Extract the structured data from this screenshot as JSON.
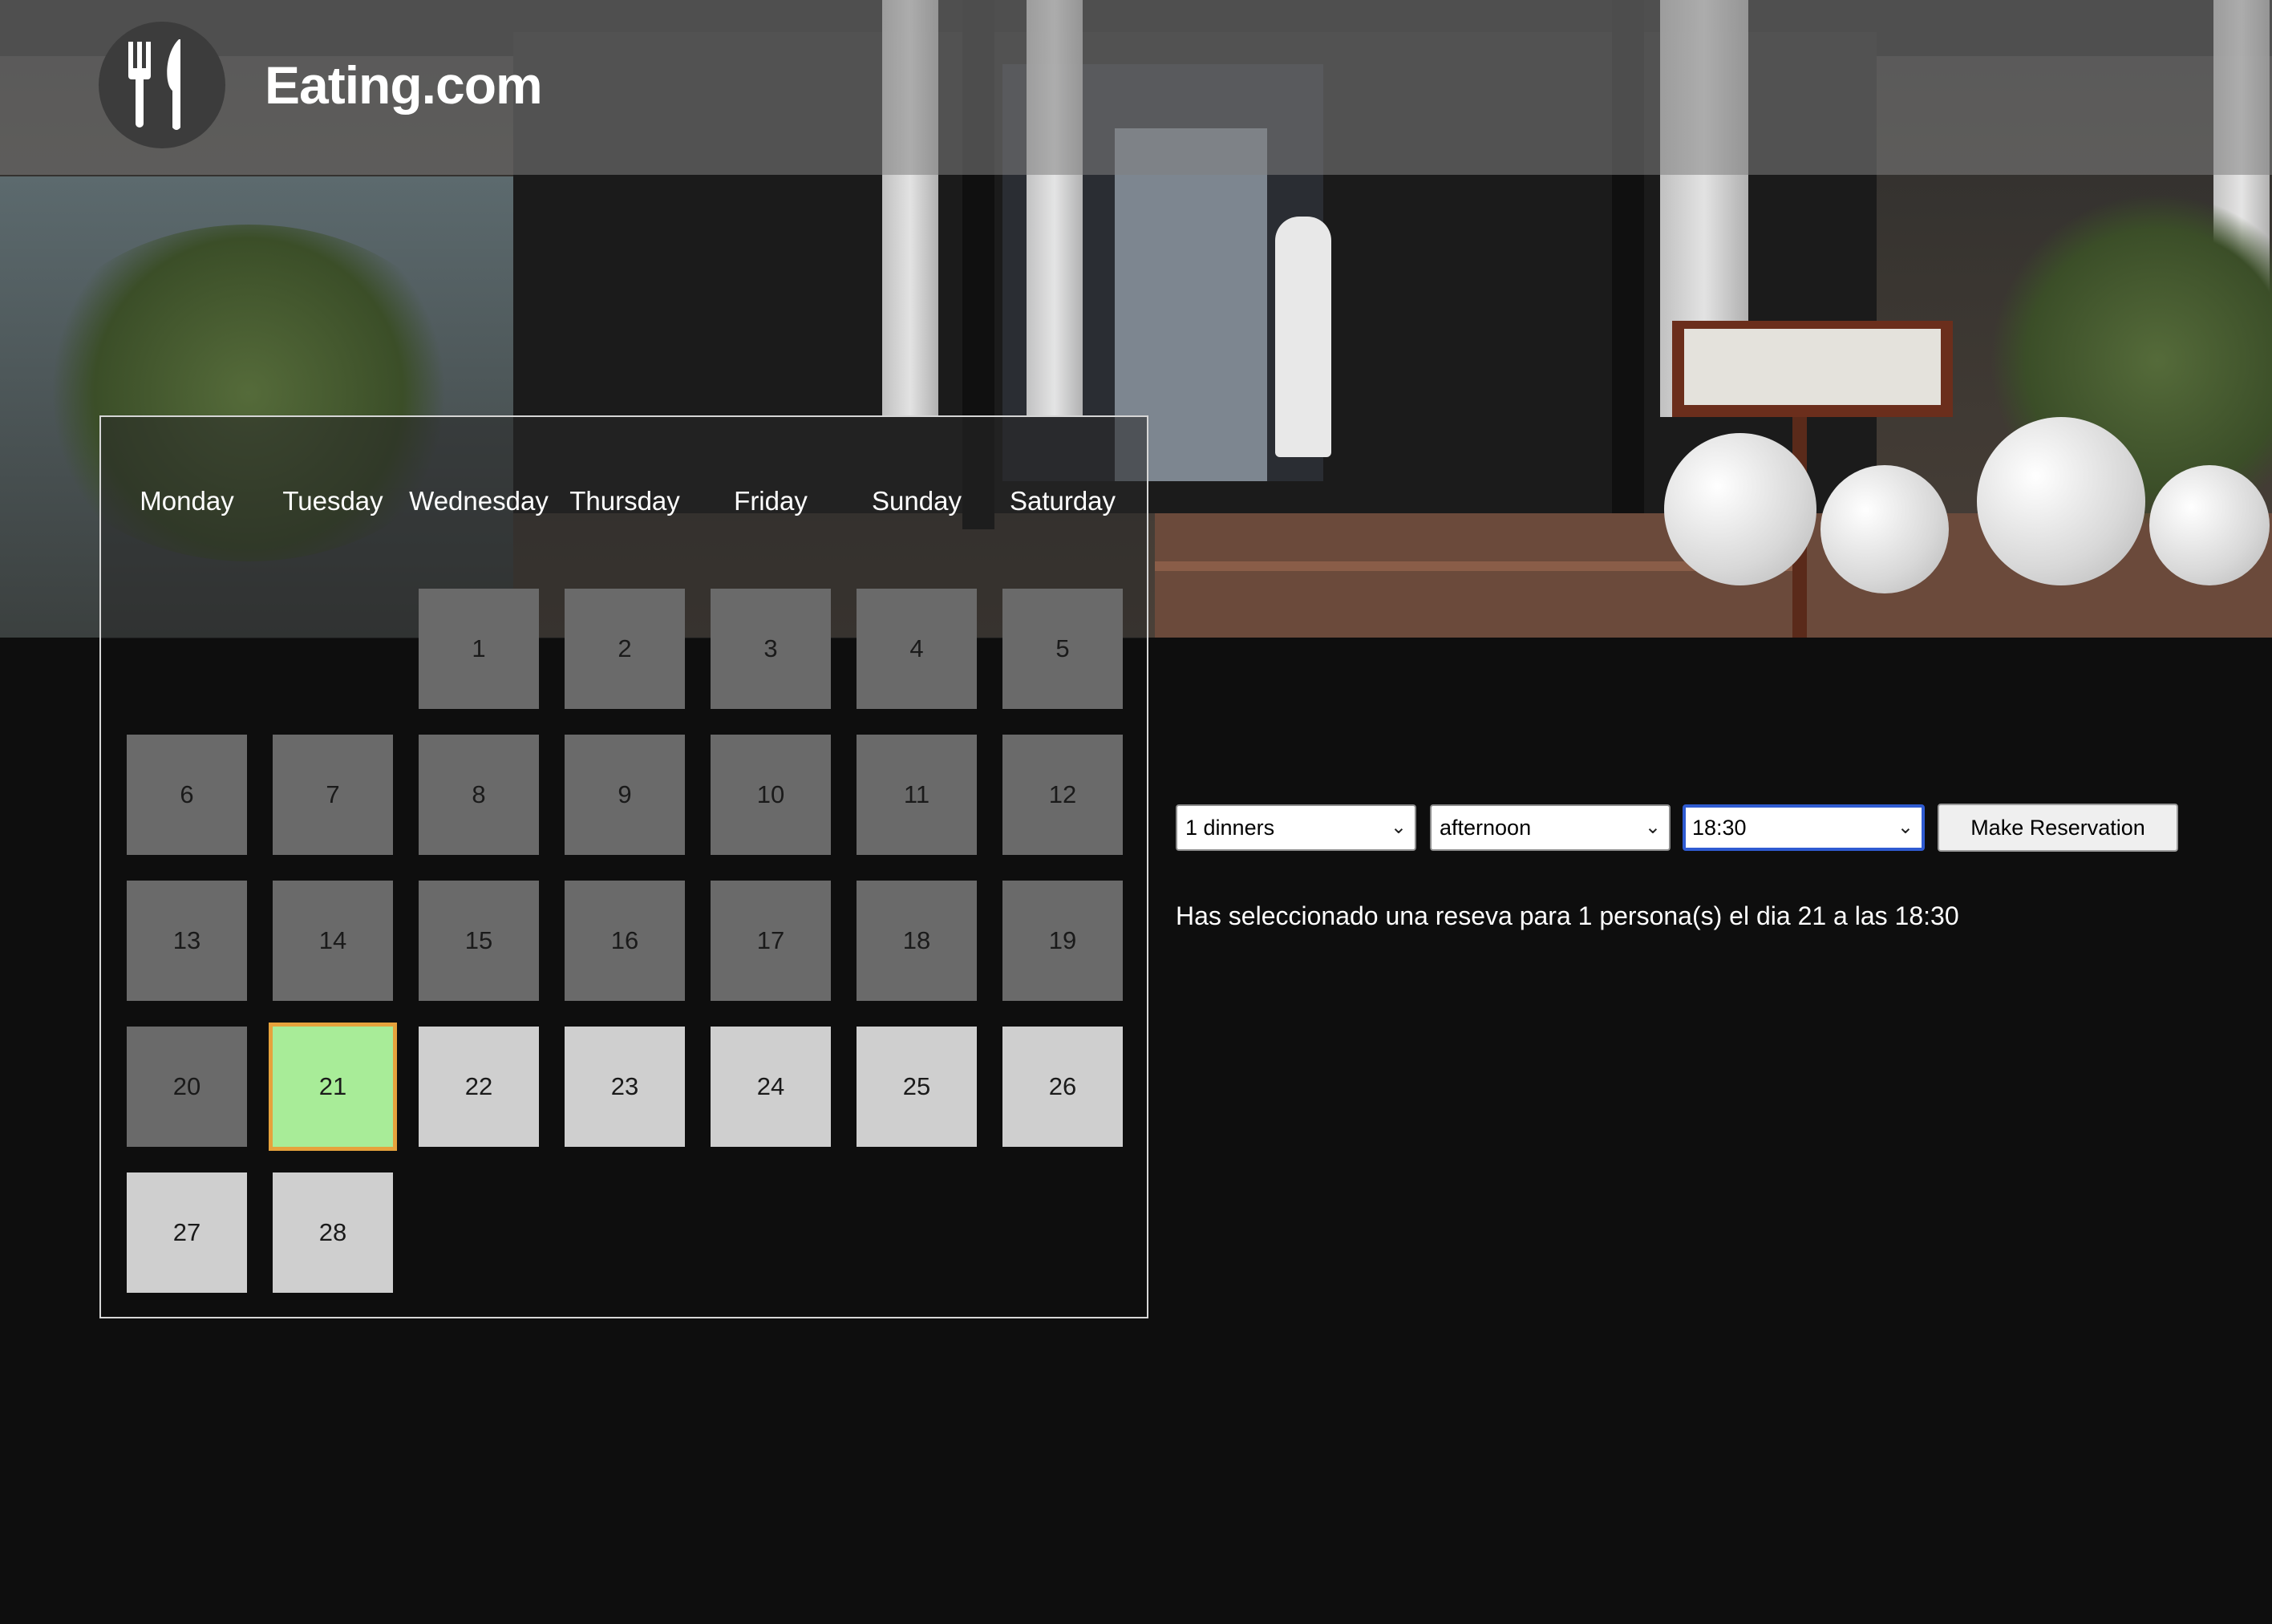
{
  "brand": {
    "name": "Eating.com",
    "logo_icon": "fork-knife-icon"
  },
  "calendar": {
    "weekdays": [
      "Monday",
      "Tuesday",
      "Wednesday",
      "Thursday",
      "Friday",
      "Sunday",
      "Saturday"
    ],
    "days": [
      {
        "n": "1",
        "state": "past"
      },
      {
        "n": "2",
        "state": "past"
      },
      {
        "n": "3",
        "state": "past"
      },
      {
        "n": "4",
        "state": "past"
      },
      {
        "n": "5",
        "state": "past"
      },
      {
        "n": "6",
        "state": "past"
      },
      {
        "n": "7",
        "state": "past"
      },
      {
        "n": "8",
        "state": "past"
      },
      {
        "n": "9",
        "state": "past"
      },
      {
        "n": "10",
        "state": "past"
      },
      {
        "n": "11",
        "state": "past"
      },
      {
        "n": "12",
        "state": "past"
      },
      {
        "n": "13",
        "state": "past"
      },
      {
        "n": "14",
        "state": "past"
      },
      {
        "n": "15",
        "state": "past"
      },
      {
        "n": "16",
        "state": "past"
      },
      {
        "n": "17",
        "state": "past"
      },
      {
        "n": "18",
        "state": "past"
      },
      {
        "n": "19",
        "state": "past"
      },
      {
        "n": "20",
        "state": "past"
      },
      {
        "n": "21",
        "state": "selected"
      },
      {
        "n": "22",
        "state": "future"
      },
      {
        "n": "23",
        "state": "future"
      },
      {
        "n": "24",
        "state": "future"
      },
      {
        "n": "25",
        "state": "future"
      },
      {
        "n": "26",
        "state": "future"
      },
      {
        "n": "27",
        "state": "future"
      },
      {
        "n": "28",
        "state": "future"
      }
    ],
    "colors": {
      "past": "#6a6a6a",
      "future": "#cfcfcf",
      "selected": "#a8ec98",
      "selected_border": "#e6a23c"
    }
  },
  "form": {
    "diners_value": "1 dinners",
    "period_value": "afternoon",
    "time_value": "18:30",
    "reserve_label": "Make Reservation"
  },
  "summary": "Has seleccionado una reseva para 1 persona(s) el dia 21 a las 18:30"
}
